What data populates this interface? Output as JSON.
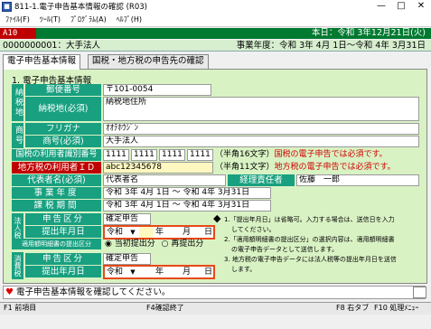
{
  "window": {
    "title": "811-1.電子申告基本情報の確認 (R03)",
    "minimize": "—",
    "maximize": "□",
    "close": "✕"
  },
  "menu": [
    "ﾌｧｲﾙ(F)",
    "ﾂｰﾙ(T)",
    "ﾌﾟﾛｸﾞﾗﾑ(A)",
    "ﾍﾙﾌﾟ(H)"
  ],
  "status": {
    "code": "A10",
    "today": "本日：令和 3年12月21日(火)"
  },
  "header": {
    "corp": "0000000001：大手法人",
    "fiscal_year": "事業年度：令和 3年 4月 1日～令和 4年 3月31日"
  },
  "tabs": [
    "電子申告基本情報",
    "国税・地方税の申告先の確認"
  ],
  "section_title": "1. 電子申告基本情報",
  "groups": {
    "taxpayer": "納税地",
    "trade_name": "商号"
  },
  "fields": {
    "postal_label": "郵便番号",
    "postal_value": "〒101-0054",
    "address_label": "納税地(必須)",
    "address_value": "納税地住所",
    "furigana_label": "フリガナ",
    "furigana_value": "ｵｵﾃﾎｳｼﾞﾝ",
    "name_label": "商号(必須)",
    "name_value": "大手法人",
    "national_id_label": "国税の利用者識別番号",
    "national_id_parts": [
      "1111",
      "1111",
      "1111",
      "1111"
    ],
    "national_id_note": "（半角16文字）",
    "national_id_warn": "国税の電子申告では必須です。",
    "local_id_label": "地方税の利用者ＩＤ",
    "local_id_value": "abc12345678",
    "local_id_note": "（半角11文字）",
    "local_id_warn": "地方税の電子申告では必須です。",
    "rep_label": "代表者名(必須)",
    "rep_value": "代表者名",
    "acct_label": "経理責任者",
    "acct_value": "佐藤　一郎",
    "fy_label": "事業年度",
    "fy_value": "令和 3年 4月 1日 ～ 令和 4年 3月31日",
    "period_label": "課税期間",
    "period_value": "令和 3年 4月 1日 ～ 令和 4年 3月31日"
  },
  "corporate_tax": {
    "group": "法人税等",
    "kind_label": "申告区分",
    "kind_value": "確定申告",
    "date_label": "提出年月日",
    "era": "令和",
    "year_unit": "年",
    "month_unit": "月",
    "day_unit": "日",
    "batch_label": "適用額明細書の提出区分",
    "radio1": "当初提出分",
    "radio2": "再提出分"
  },
  "consumption_tax": {
    "group": "消費税",
    "kind_label": "申告区分",
    "kind_value": "確定申告",
    "date_label": "提出年月日",
    "era": "令和",
    "year_unit": "年",
    "month_unit": "月",
    "day_unit": "日"
  },
  "notes": {
    "bullet": "◆",
    "n1": "1.「提出年月日」は省略可。入力する場合は、送信日を入力",
    "n1b": "してください。",
    "n2": "2.「適用額明細書の提出区分」の選択内容は、適用額明細書",
    "n2b": "の電子申告データとして送信します。",
    "n3": "3. 地方税の電子申告データには法人税等の提出年月日を送信",
    "n3b": "します。"
  },
  "message": {
    "icon": "heart-icon",
    "text": "電子申告基本情報を確認してください。"
  },
  "fkeys": [
    {
      "key": "F1",
      "label": "前項目"
    },
    {
      "key": "F4",
      "label": "確認終了"
    },
    {
      "key": "F8",
      "label": "右タブ"
    },
    {
      "key": "F10",
      "label": "処理ﾒﾆｭｰ"
    }
  ],
  "colors": {
    "green": "#18a080",
    "red": "#c00000",
    "panel": "#d9f2c4",
    "status": "#007a30"
  }
}
